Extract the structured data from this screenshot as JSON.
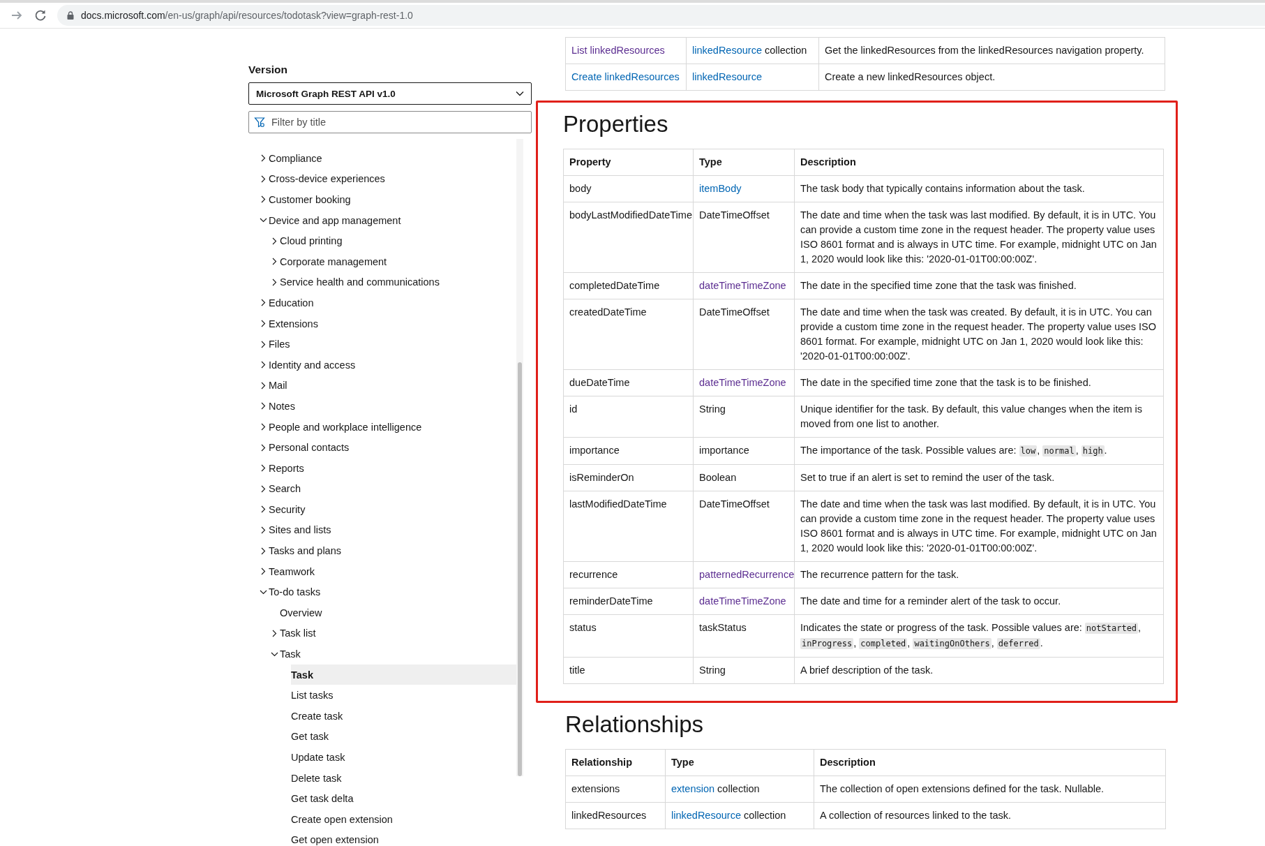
{
  "browser": {
    "url_host": "docs.microsoft.com",
    "url_path": "/en-us/graph/api/resources/todotask?view=graph-rest-1.0"
  },
  "sidebar": {
    "version_label": "Version",
    "version_value": "Microsoft Graph REST API v1.0",
    "filter": {
      "placeholder": "Filter by title"
    },
    "items": [
      {
        "label": "Compliance",
        "kind": "folder",
        "expanded": false,
        "selected": false
      },
      {
        "label": "Cross-device experiences",
        "kind": "folder",
        "expanded": false,
        "selected": false
      },
      {
        "label": "Customer booking",
        "kind": "folder",
        "expanded": false,
        "selected": false
      },
      {
        "label": "Device and app management",
        "kind": "folder",
        "expanded": true,
        "selected": false,
        "children": [
          {
            "label": "Cloud printing",
            "kind": "folder",
            "expanded": false,
            "selected": false
          },
          {
            "label": "Corporate management",
            "kind": "folder",
            "expanded": false,
            "selected": false
          },
          {
            "label": "Service health and communications",
            "kind": "folder",
            "expanded": false,
            "selected": false
          }
        ]
      },
      {
        "label": "Education",
        "kind": "folder",
        "expanded": false,
        "selected": false
      },
      {
        "label": "Extensions",
        "kind": "folder",
        "expanded": false,
        "selected": false
      },
      {
        "label": "Files",
        "kind": "folder",
        "expanded": false,
        "selected": false
      },
      {
        "label": "Identity and access",
        "kind": "folder",
        "expanded": false,
        "selected": false
      },
      {
        "label": "Mail",
        "kind": "folder",
        "expanded": false,
        "selected": false
      },
      {
        "label": "Notes",
        "kind": "folder",
        "expanded": false,
        "selected": false
      },
      {
        "label": "People and workplace intelligence",
        "kind": "folder",
        "expanded": false,
        "selected": false
      },
      {
        "label": "Personal contacts",
        "kind": "folder",
        "expanded": false,
        "selected": false
      },
      {
        "label": "Reports",
        "kind": "folder",
        "expanded": false,
        "selected": false
      },
      {
        "label": "Search",
        "kind": "folder",
        "expanded": false,
        "selected": false
      },
      {
        "label": "Security",
        "kind": "folder",
        "expanded": false,
        "selected": false
      },
      {
        "label": "Sites and lists",
        "kind": "folder",
        "expanded": false,
        "selected": false
      },
      {
        "label": "Tasks and plans",
        "kind": "folder",
        "expanded": false,
        "selected": false
      },
      {
        "label": "Teamwork",
        "kind": "folder",
        "expanded": false,
        "selected": false
      },
      {
        "label": "To-do tasks",
        "kind": "folder",
        "expanded": true,
        "selected": false,
        "children": [
          {
            "label": "Overview",
            "kind": "page",
            "selected": false
          },
          {
            "label": "Task list",
            "kind": "folder",
            "expanded": false,
            "selected": false
          },
          {
            "label": "Task",
            "kind": "folder",
            "expanded": true,
            "selected": false,
            "children": [
              {
                "label": "Task",
                "kind": "page",
                "selected": true
              },
              {
                "label": "List tasks",
                "kind": "page",
                "selected": false
              },
              {
                "label": "Create task",
                "kind": "page",
                "selected": false
              },
              {
                "label": "Get task",
                "kind": "page",
                "selected": false
              },
              {
                "label": "Update task",
                "kind": "page",
                "selected": false
              },
              {
                "label": "Delete task",
                "kind": "page",
                "selected": false
              },
              {
                "label": "Get task delta",
                "kind": "page",
                "selected": false
              },
              {
                "label": "Create open extension",
                "kind": "page",
                "selected": false
              },
              {
                "label": "Get open extension",
                "kind": "page",
                "selected": false
              }
            ]
          }
        ]
      }
    ]
  },
  "methods_table": {
    "rows": [
      {
        "method": {
          "text": "List linkedResources",
          "visited": true
        },
        "type": {
          "link": "linkedResource",
          "visited": false,
          "suffix": " collection"
        },
        "description": [
          {
            "kind": "text",
            "text": "Get the linkedResources from the linkedResources navigation property."
          }
        ]
      },
      {
        "method": {
          "text": "Create linkedResources",
          "visited": false
        },
        "type": {
          "link": "linkedResource",
          "visited": false
        },
        "description": [
          {
            "kind": "text",
            "text": "Create a new linkedResources object."
          }
        ]
      }
    ]
  },
  "properties": {
    "heading": "Properties",
    "columns": [
      "Property",
      "Type",
      "Description"
    ],
    "rows": [
      {
        "property": "body",
        "type": {
          "link": "itemBody",
          "visited": false
        },
        "description": [
          {
            "kind": "text",
            "text": "The task body that typically contains information about the task."
          }
        ]
      },
      {
        "property": "bodyLastModifiedDateTime",
        "type": {
          "text": "DateTimeOffset"
        },
        "description": [
          {
            "kind": "text",
            "text": "The date and time when the task was last modified. By default, it is in UTC. You can provide a custom time zone in the request header. The property value uses ISO 8601 format and is always in UTC time. For example, midnight UTC on Jan 1, 2020 would look like this: '2020-01-01T00:00:00Z'."
          }
        ]
      },
      {
        "property": "completedDateTime",
        "type": {
          "link": "dateTimeTimeZone",
          "visited": true
        },
        "description": [
          {
            "kind": "text",
            "text": "The date in the specified time zone that the task was finished."
          }
        ]
      },
      {
        "property": "createdDateTime",
        "type": {
          "text": "DateTimeOffset"
        },
        "description": [
          {
            "kind": "text",
            "text": "The date and time when the task was created. By default, it is in UTC. You can provide a custom time zone in the request header. The property value uses ISO 8601 format. For example, midnight UTC on Jan 1, 2020 would look like this: '2020-01-01T00:00:00Z'."
          }
        ]
      },
      {
        "property": "dueDateTime",
        "type": {
          "link": "dateTimeTimeZone",
          "visited": true
        },
        "description": [
          {
            "kind": "text",
            "text": "The date in the specified time zone that the task is to be finished."
          }
        ]
      },
      {
        "property": "id",
        "type": {
          "text": "String"
        },
        "description": [
          {
            "kind": "text",
            "text": "Unique identifier for the task. By default, this value changes when the item is moved from one list to another."
          }
        ]
      },
      {
        "property": "importance",
        "type": {
          "text": "importance"
        },
        "description": [
          {
            "kind": "text",
            "text": "The importance of the task. Possible values are: "
          },
          {
            "kind": "code",
            "text": "low"
          },
          {
            "kind": "text",
            "text": ", "
          },
          {
            "kind": "code",
            "text": "normal"
          },
          {
            "kind": "text",
            "text": ", "
          },
          {
            "kind": "code",
            "text": "high"
          },
          {
            "kind": "text",
            "text": "."
          }
        ]
      },
      {
        "property": "isReminderOn",
        "type": {
          "text": "Boolean"
        },
        "description": [
          {
            "kind": "text",
            "text": "Set to true if an alert is set to remind the user of the task."
          }
        ]
      },
      {
        "property": "lastModifiedDateTime",
        "type": {
          "text": "DateTimeOffset"
        },
        "description": [
          {
            "kind": "text",
            "text": "The date and time when the task was last modified. By default, it is in UTC. You can provide a custom time zone in the request header. The property value uses ISO 8601 format and is always in UTC time. For example, midnight UTC on Jan 1, 2020 would look like this: '2020-01-01T00:00:00Z'."
          }
        ]
      },
      {
        "property": "recurrence",
        "type": {
          "link": "patternedRecurrence",
          "visited": true
        },
        "description": [
          {
            "kind": "text",
            "text": "The recurrence pattern for the task."
          }
        ]
      },
      {
        "property": "reminderDateTime",
        "type": {
          "link": "dateTimeTimeZone",
          "visited": true
        },
        "description": [
          {
            "kind": "text",
            "text": "The date and time for a reminder alert of the task to occur."
          }
        ]
      },
      {
        "property": "status",
        "type": {
          "text": "taskStatus"
        },
        "description": [
          {
            "kind": "text",
            "text": "Indicates the state or progress of the task. Possible values are: "
          },
          {
            "kind": "code",
            "text": "notStarted"
          },
          {
            "kind": "text",
            "text": ", "
          },
          {
            "kind": "code",
            "text": "inProgress"
          },
          {
            "kind": "text",
            "text": ", "
          },
          {
            "kind": "code",
            "text": "completed"
          },
          {
            "kind": "text",
            "text": ", "
          },
          {
            "kind": "code",
            "text": "waitingOnOthers"
          },
          {
            "kind": "text",
            "text": ", "
          },
          {
            "kind": "code",
            "text": "deferred"
          },
          {
            "kind": "text",
            "text": "."
          }
        ]
      },
      {
        "property": "title",
        "type": {
          "text": "String"
        },
        "description": [
          {
            "kind": "text",
            "text": "A brief description of the task."
          }
        ]
      }
    ]
  },
  "relationships": {
    "heading": "Relationships",
    "columns": [
      "Relationship",
      "Type",
      "Description"
    ],
    "rows": [
      {
        "property": "extensions",
        "type": {
          "link": "extension",
          "visited": false,
          "suffix": " collection"
        },
        "description": [
          {
            "kind": "text",
            "text": "The collection of open extensions defined for the task. Nullable."
          }
        ]
      },
      {
        "property": "linkedResources",
        "type": {
          "link": "linkedResource",
          "visited": false,
          "suffix": " collection"
        },
        "description": [
          {
            "kind": "text",
            "text": "A collection of resources linked to the task."
          }
        ]
      }
    ]
  }
}
